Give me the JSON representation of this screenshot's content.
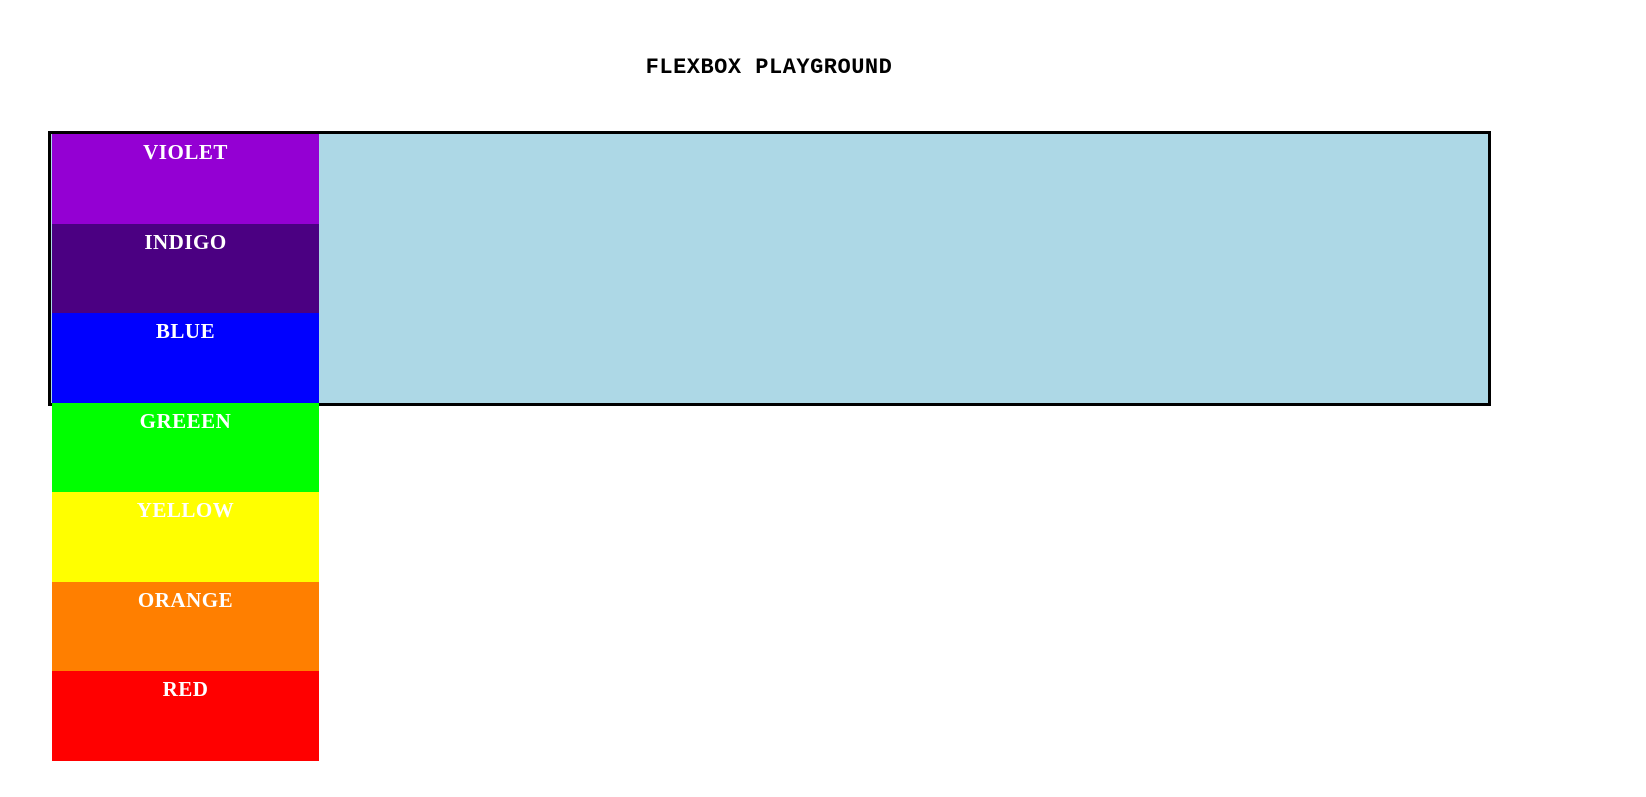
{
  "page": {
    "title": "FLEXBOX PLAYGROUND"
  },
  "container": {
    "background": "#add8e6",
    "border_color": "#000000"
  },
  "boxes": [
    {
      "label": "VIOLET",
      "color": "#9400d3"
    },
    {
      "label": "INDIGO",
      "color": "#4b0082"
    },
    {
      "label": "BLUE",
      "color": "#0000ff"
    },
    {
      "label": "GREEEN",
      "color": "#00ff00"
    },
    {
      "label": "YELLOW",
      "color": "#ffff00"
    },
    {
      "label": "ORANGE",
      "color": "#ff7f00"
    },
    {
      "label": "RED",
      "color": "#ff0000"
    }
  ]
}
